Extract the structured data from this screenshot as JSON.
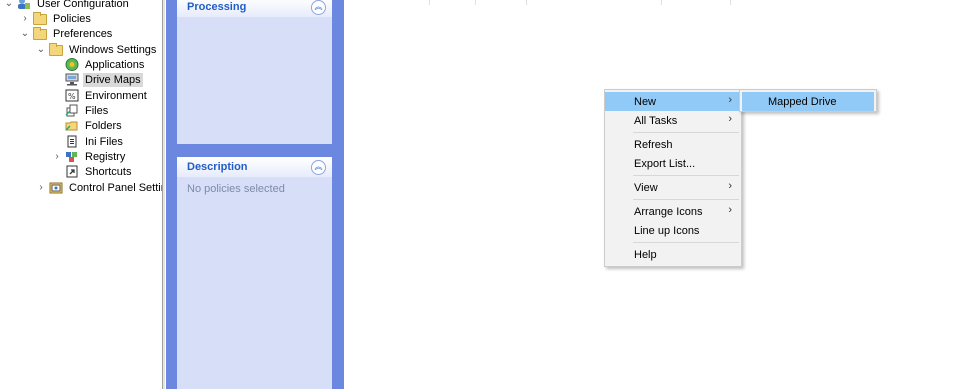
{
  "tree": {
    "items": [
      {
        "label": "User Configuration",
        "expander": "expanded",
        "icon": "user-config-icon"
      },
      {
        "label": "Policies",
        "expander": "collapsed",
        "icon": "folder-icon"
      },
      {
        "label": "Preferences",
        "expander": "expanded",
        "icon": "folder-icon"
      },
      {
        "label": "Windows Settings",
        "expander": "expanded",
        "icon": "folder-icon"
      },
      {
        "label": "Applications",
        "expander": "",
        "icon": "applications-icon"
      },
      {
        "label": "Drive Maps",
        "expander": "",
        "icon": "drive-maps-icon"
      },
      {
        "label": "Environment",
        "expander": "",
        "icon": "environment-icon"
      },
      {
        "label": "Files",
        "expander": "",
        "icon": "files-icon"
      },
      {
        "label": "Folders",
        "expander": "",
        "icon": "folders-icon"
      },
      {
        "label": "Ini Files",
        "expander": "",
        "icon": "ini-files-icon"
      },
      {
        "label": "Registry",
        "expander": "collapsed",
        "icon": "registry-icon"
      },
      {
        "label": "Shortcuts",
        "expander": "",
        "icon": "shortcuts-icon"
      },
      {
        "label": "Control Panel Setting",
        "expander": "collapsed",
        "icon": "control-panel-icon"
      }
    ],
    "selected": "Drive Maps"
  },
  "taskpane": {
    "processing_title": "Processing",
    "description_title": "Description",
    "description_text": "No policies selected",
    "collapse_glyph": "︽"
  },
  "context_menu": {
    "items": [
      "New",
      "All Tasks",
      "Refresh",
      "Export List...",
      "View",
      "Arrange Icons",
      "Line up Icons",
      "Help"
    ],
    "submenu_arrow": "›"
  },
  "submenu": {
    "items": [
      "Mapped Drive"
    ]
  },
  "colors": {
    "taskpane_bg": "#6b87e0",
    "panel_title": "#215dc6",
    "menu_highlight": "#91c9f7"
  }
}
